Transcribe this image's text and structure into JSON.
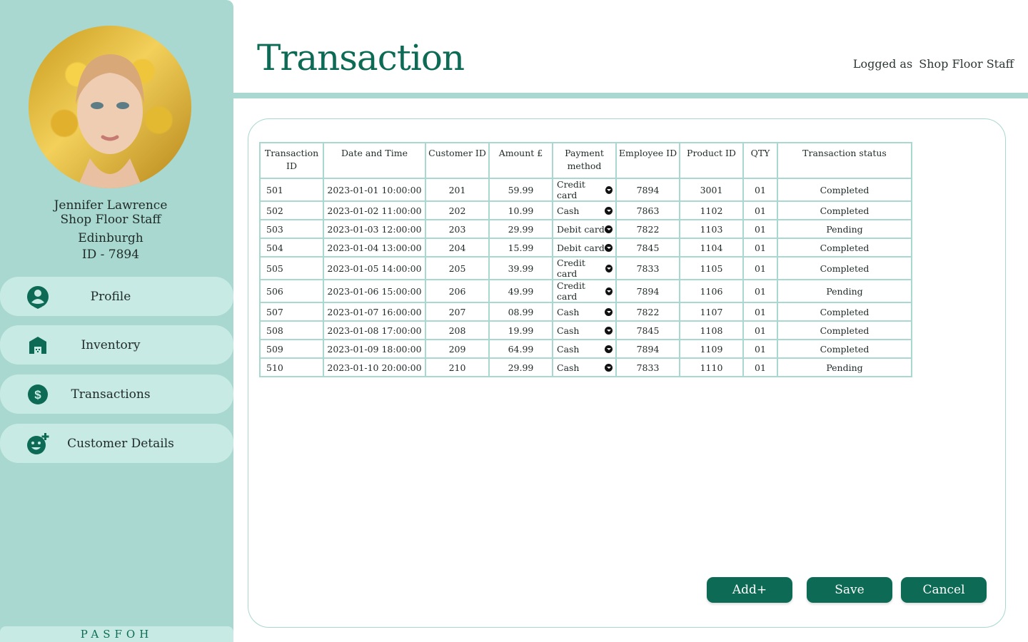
{
  "page": {
    "title": "Transaction",
    "logged_as_label": "Logged as",
    "logged_as_role": "Shop Floor Staff"
  },
  "profile": {
    "name": "Jennifer Lawrence",
    "role": "Shop Floor Staff",
    "location": "Edinburgh",
    "id": "ID - 7894"
  },
  "nav": [
    {
      "label": "Profile",
      "icon": "user-pin-icon"
    },
    {
      "label": "Inventory",
      "icon": "warehouse-icon"
    },
    {
      "label": "Transactions",
      "icon": "dollar-circle-icon"
    },
    {
      "label": "Customer Details",
      "icon": "add-reaction-icon"
    }
  ],
  "brand": "PASFOH",
  "table": {
    "columns": [
      "Transaction ID",
      "Date and Time",
      "Customer ID",
      "Amount £",
      "Payment method",
      "Employee ID",
      "Product ID",
      "QTY",
      "Transaction status"
    ],
    "rows": [
      [
        "501",
        "2023-01-01 10:00:00",
        "201",
        "59.99",
        "Credit card",
        "7894",
        "3001",
        "01",
        "Completed"
      ],
      [
        "502",
        "2023-01-02 11:00:00",
        "202",
        "10.99",
        "Cash",
        "7863",
        "1102",
        "01",
        "Completed"
      ],
      [
        "503",
        "2023-01-03 12:00:00",
        "203",
        "29.99",
        "Debit card",
        "7822",
        "1103",
        "01",
        "Pending"
      ],
      [
        "504",
        "2023-01-04 13:00:00",
        "204",
        "15.99",
        "Debit card",
        "7845",
        "1104",
        "01",
        "Completed"
      ],
      [
        "505",
        "2023-01-05 14:00:00",
        "205",
        "39.99",
        "Credit card",
        "7833",
        "1105",
        "01",
        "Completed"
      ],
      [
        "506",
        "2023-01-06 15:00:00",
        "206",
        "49.99",
        "Credit card",
        "7894",
        "1106",
        "01",
        "Pending"
      ],
      [
        "507",
        "2023-01-07 16:00:00",
        "207",
        "08.99",
        "Cash",
        "7822",
        "1107",
        "01",
        "Completed"
      ],
      [
        "508",
        "2023-01-08 17:00:00",
        "208",
        "19.99",
        "Cash",
        "7845",
        "1108",
        "01",
        "Completed"
      ],
      [
        "509",
        "2023-01-09 18:00:00",
        "209",
        "64.99",
        "Cash",
        "7894",
        "1109",
        "01",
        "Completed"
      ],
      [
        "510",
        "2023-01-10 20:00:00",
        "210",
        "29.99",
        "Cash",
        "7833",
        "1110",
        "01",
        "Pending"
      ]
    ]
  },
  "buttons": {
    "add": "Add+",
    "save": "Save",
    "cancel": "Cancel"
  },
  "colors": {
    "accent": "#0d6b55",
    "sidebar": "#a8d8cf",
    "nav_item": "#c7ebe4"
  }
}
